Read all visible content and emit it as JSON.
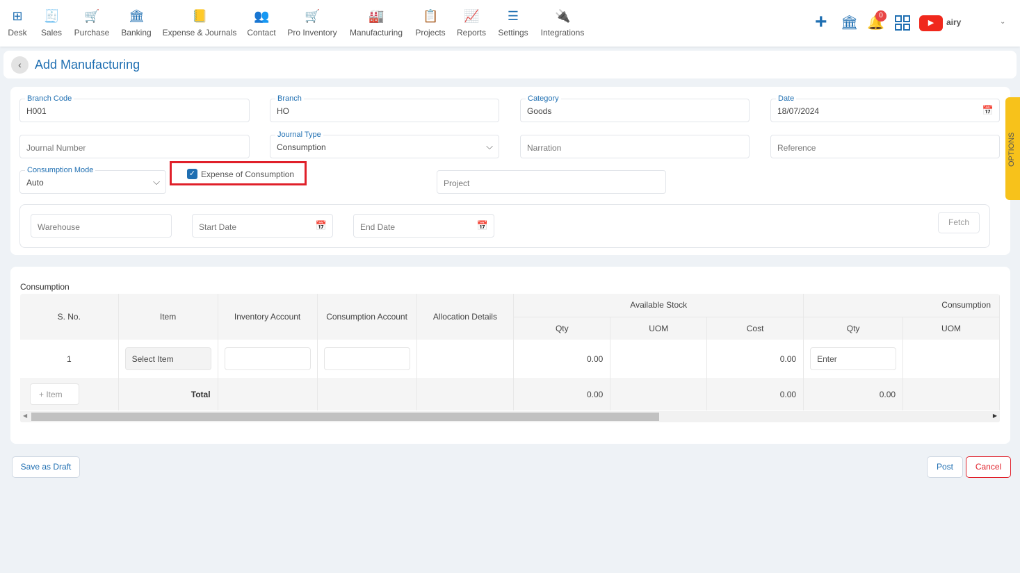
{
  "nav": [
    {
      "label": "Desk",
      "icon": "grid-plus-icon"
    },
    {
      "label": "Sales",
      "icon": "receipt-icon"
    },
    {
      "label": "Purchase",
      "icon": "cart-icon"
    },
    {
      "label": "Banking",
      "icon": "bank-icon"
    },
    {
      "label": "Expense & Journals",
      "icon": "journal-icon"
    },
    {
      "label": "Contact",
      "icon": "contacts-icon"
    },
    {
      "label": "Pro Inventory",
      "icon": "inventory-trolley-icon"
    },
    {
      "label": "Manufacturing",
      "icon": "factory-icon"
    },
    {
      "label": "Projects",
      "icon": "projects-icon"
    },
    {
      "label": "Reports",
      "icon": "report-chart-icon"
    },
    {
      "label": "Settings",
      "icon": "sliders-icon"
    },
    {
      "label": "Integrations",
      "icon": "plug-icon"
    }
  ],
  "header": {
    "notifications": "0",
    "user": "airy",
    "title": "Add Manufacturing",
    "options": "OPTIONS"
  },
  "form": {
    "branch_code": {
      "label": "Branch Code",
      "value": "H001"
    },
    "branch": {
      "label": "Branch",
      "value": "HO"
    },
    "category": {
      "label": "Category",
      "value": "Goods"
    },
    "date": {
      "label": "Date",
      "value": "18/07/2024"
    },
    "journal_number": {
      "placeholder": "Journal Number"
    },
    "journal_type": {
      "label": "Journal Type",
      "value": "Consumption"
    },
    "narration": {
      "placeholder": "Narration"
    },
    "reference": {
      "placeholder": "Reference"
    },
    "consumption_mode": {
      "label": "Consumption Mode",
      "value": "Auto"
    },
    "expense_of_consumption": {
      "label": "Expense of Consumption",
      "checked": true
    },
    "project": {
      "placeholder": "Project"
    },
    "warehouse": {
      "placeholder": "Warehouse"
    },
    "start_date": {
      "placeholder": "Start Date"
    },
    "end_date": {
      "placeholder": "End Date"
    },
    "fetch": "Fetch"
  },
  "table": {
    "title": "Consumption",
    "group_available": "Available Stock",
    "group_consumption": "Consumption",
    "headers": [
      "S. No.",
      "Item",
      "Inventory Account",
      "Consumption Account",
      "Allocation Details",
      "Qty",
      "UOM",
      "Cost",
      "Qty",
      "UOM"
    ],
    "row": {
      "sno": "1",
      "item": "Select Item",
      "avail_qty": "0.00",
      "cost": "0.00",
      "qty_placeholder": "Enter"
    },
    "total": {
      "add_item": "Item",
      "label": "Total",
      "avail_qty": "0.00",
      "cost": "0.00",
      "qty": "0.00"
    }
  },
  "footer": {
    "save_draft": "Save as Draft",
    "post": "Post",
    "cancel": "Cancel"
  },
  "colors": {
    "accent": "#1f6fb2",
    "highlight": "#e0202a",
    "options_tab": "#f7c21b"
  }
}
